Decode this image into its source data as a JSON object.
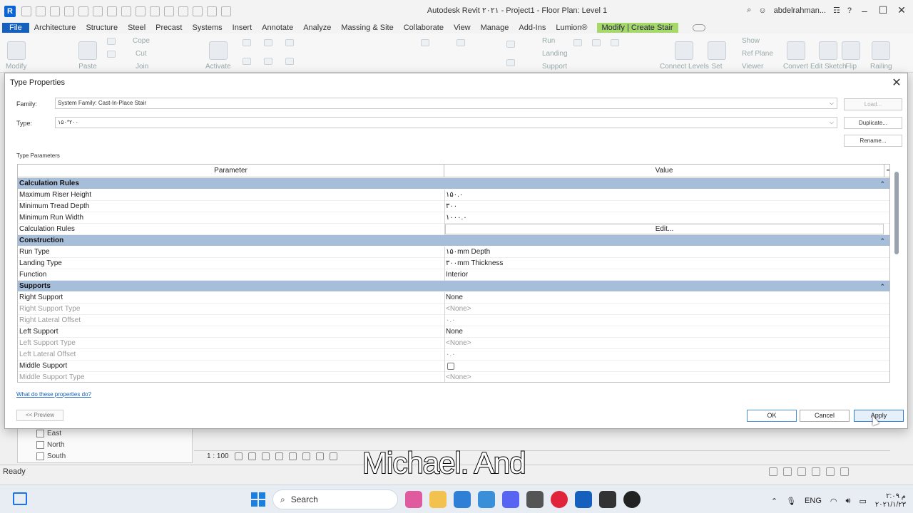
{
  "window": {
    "logo": "R",
    "title": "Autodesk Revit ۲۰۲۱ - Project1 - Floor Plan: Level 1",
    "user": "abdelrahman...",
    "help": "?"
  },
  "ribbon": {
    "tabs": [
      "File",
      "Architecture",
      "Structure",
      "Steel",
      "Precast",
      "Systems",
      "Insert",
      "Annotate",
      "Analyze",
      "Massing & Site",
      "Collaborate",
      "View",
      "Manage",
      "Add-Ins",
      "Lumion®"
    ],
    "contextual_tab": "Modify | Create Stair",
    "groups": [
      "Modify",
      "Paste",
      "Cope",
      "Cut",
      "Join",
      "Activate",
      "Run",
      "Landing",
      "Support",
      "Connect Levels",
      "Set",
      "Show",
      "Ref Plane",
      "Viewer",
      "Convert",
      "Edit Sketch",
      "Flip",
      "Railing"
    ]
  },
  "dialog": {
    "title": "Type Properties",
    "family_label": "Family:",
    "family_value": "System Family: Cast-In-Place Stair",
    "type_label": "Type:",
    "type_value": "۱۵۰*۲۰۰",
    "load_button": "Load...",
    "duplicate_button": "Duplicate...",
    "rename_button": "Rename...",
    "section_label": "Type Parameters",
    "col_parameter": "Parameter",
    "col_value": "Value",
    "sort_glyph": "=",
    "groups": [
      {
        "name": "Calculation Rules",
        "rows": [
          {
            "name": "Maximum Riser Height",
            "value": "۱۵۰.۰",
            "dim": false
          },
          {
            "name": "Minimum Tread Depth",
            "value": "۳۰۰",
            "dim": false
          },
          {
            "name": "Minimum Run Width",
            "value": "۱۰۰۰.۰",
            "dim": false
          },
          {
            "name": "Calculation Rules",
            "value": "Edit...",
            "dim": false,
            "button": true
          }
        ]
      },
      {
        "name": "Construction",
        "rows": [
          {
            "name": "Run Type",
            "value": "۱۵۰mm Depth",
            "dim": false
          },
          {
            "name": "Landing Type",
            "value": "۳۰۰mm Thickness",
            "dim": false
          },
          {
            "name": "Function",
            "value": "Interior",
            "dim": false
          }
        ]
      },
      {
        "name": "Supports",
        "rows": [
          {
            "name": "Right Support",
            "value": "None",
            "dim": false
          },
          {
            "name": "Right Support Type",
            "value": "<None>",
            "dim": true
          },
          {
            "name": "Right Lateral Offset",
            "value": "۰.۰",
            "dim": true
          },
          {
            "name": "Left Support",
            "value": "None",
            "dim": false
          },
          {
            "name": "Left Support Type",
            "value": "<None>",
            "dim": true
          },
          {
            "name": "Left Lateral Offset",
            "value": "۰.۰",
            "dim": true
          },
          {
            "name": "Middle Support",
            "value": "",
            "dim": false,
            "checkbox": true
          },
          {
            "name": "Middle Support Type",
            "value": "<None>",
            "dim": true
          }
        ]
      }
    ],
    "help_link": "What do these properties do?",
    "preview_button": "<< Preview",
    "ok_button": "OK",
    "cancel_button": "Cancel",
    "apply_button": "Apply"
  },
  "project_browser": {
    "items": [
      "East",
      "North",
      "South"
    ]
  },
  "view_bar": {
    "scale": "1 : 100"
  },
  "status": {
    "text": "Ready"
  },
  "caption": "Michael. And",
  "taskbar": {
    "search_placeholder": "Search",
    "language": "ENG",
    "time": "۲:۰۹ م",
    "date": "۲۰۲۱/۱/۲۳"
  }
}
